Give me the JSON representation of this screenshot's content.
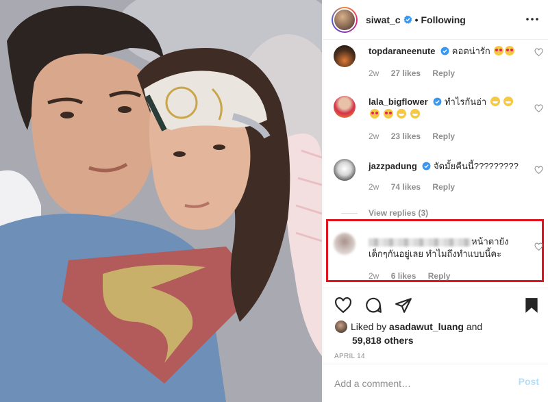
{
  "header": {
    "username": "siwat_c",
    "verified_icon": "verified-badge-icon",
    "separator": "•",
    "follow_status": "Following",
    "more_icon": "more-options-icon"
  },
  "comments": [
    {
      "username": "topdaraneenute",
      "text": "คอตน่ารัก",
      "emojis": [
        "love",
        "love"
      ],
      "time": "2w",
      "likes": "27 likes",
      "reply": "Reply"
    },
    {
      "username": "lala_bigflower",
      "text": "ทำไรกันอ่า",
      "emojis": [
        "grin",
        "grin",
        "love",
        "love",
        "grin",
        "grin"
      ],
      "time": "2w",
      "likes": "23 likes",
      "reply": "Reply"
    },
    {
      "username": "jazzpadung",
      "text": "จัดมั้ยคืนนี้?????????",
      "emojis": [],
      "time": "2w",
      "likes": "74 likes",
      "reply": "Reply"
    },
    {
      "username": "",
      "text_line1": "หน้าตายัง",
      "text_line2": "เด็กๆกันอยู่เลย ทำไมถึงทำแบบนี้คะ",
      "time": "2w",
      "likes": "6 likes",
      "reply": "Reply"
    }
  ],
  "view_replies": "View replies (3)",
  "actions": {
    "like_icon": "heart-icon",
    "comment_icon": "comment-bubble-icon",
    "share_icon": "paper-plane-icon",
    "save_icon": "bookmark-icon"
  },
  "liked_by": {
    "prefix": "Liked by",
    "user": "asadawut_luang",
    "conjunction": "and",
    "others": "59,818 others"
  },
  "date": "APRIL 14",
  "add_comment": {
    "placeholder": "Add a comment…",
    "post_label": "Post"
  },
  "colors": {
    "verified": "#3897f0",
    "highlight_border": "#e0141e",
    "post_disabled": "#b2dffc",
    "muted_text": "#8e8e8e"
  }
}
